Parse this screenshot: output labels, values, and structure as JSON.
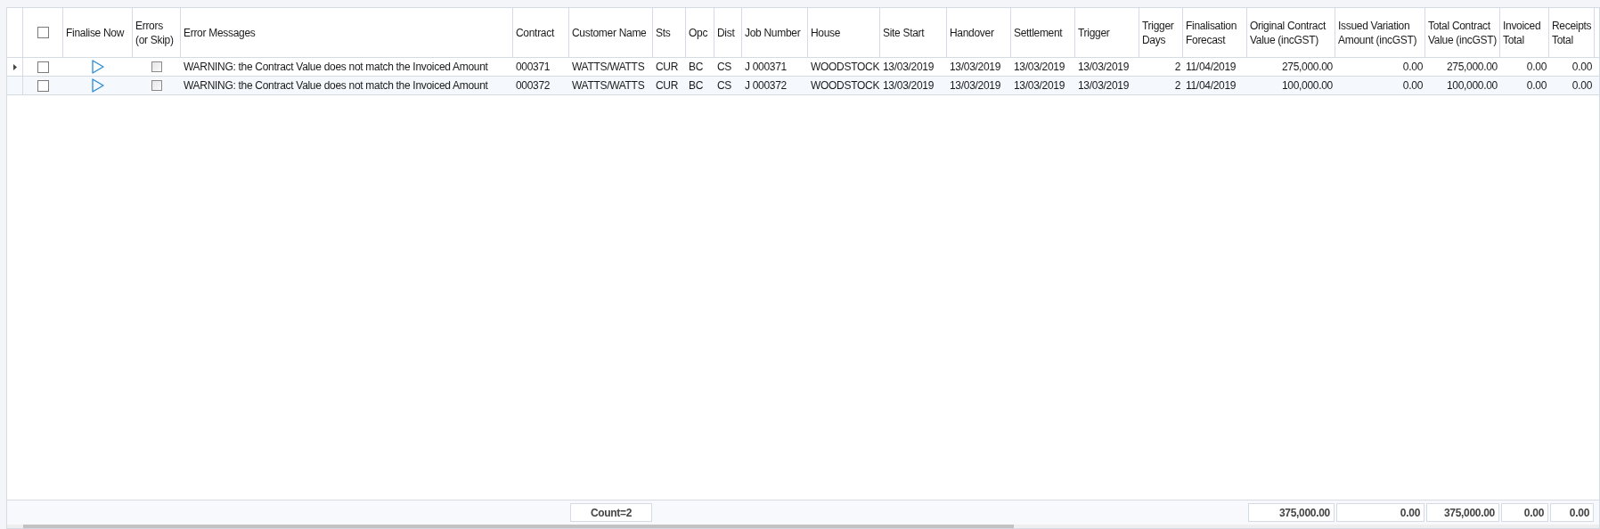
{
  "header_checkbox": {
    "checked": false
  },
  "columns": [
    {
      "label": "Finalise Now",
      "kind": "icon"
    },
    {
      "label": "Errors (or Skip)",
      "kind": "check"
    },
    {
      "label": "Error Messages",
      "kind": "text"
    },
    {
      "label": "Contract",
      "kind": "text"
    },
    {
      "label": "Customer Name",
      "kind": "text"
    },
    {
      "label": "Sts",
      "kind": "text"
    },
    {
      "label": "Opc",
      "kind": "text"
    },
    {
      "label": "Dist",
      "kind": "text"
    },
    {
      "label": "Job Number",
      "kind": "text"
    },
    {
      "label": "House",
      "kind": "text"
    },
    {
      "label": "Site Start",
      "kind": "text"
    },
    {
      "label": "Handover",
      "kind": "text"
    },
    {
      "label": "Settlement",
      "kind": "text"
    },
    {
      "label": "Trigger",
      "kind": "text"
    },
    {
      "label": "Trigger Days",
      "kind": "number"
    },
    {
      "label": "Finalisation Forecast",
      "kind": "text"
    },
    {
      "label": "Original Contract Value (incGST)",
      "kind": "number"
    },
    {
      "label": "Issued Variation Amount (incGST)",
      "kind": "number"
    },
    {
      "label": "Total Contract Value (incGST)",
      "kind": "number"
    },
    {
      "label": "Invoiced Total",
      "kind": "number"
    },
    {
      "label": "Receipts Total",
      "kind": "number"
    }
  ],
  "rows": [
    {
      "current": true,
      "checked": false,
      "skip": false,
      "cells": [
        "WARNING: the Contract Value does not match the Invoiced Amount",
        "000371",
        "WATTS/WATTS",
        "CUR",
        "BC",
        "CS",
        "J 000371",
        "WOODSTOCK",
        "13/03/2019",
        "13/03/2019",
        "13/03/2019",
        "13/03/2019",
        "2",
        "11/04/2019",
        "275,000.00",
        "0.00",
        "275,000.00",
        "0.00",
        "0.00"
      ]
    },
    {
      "current": false,
      "checked": false,
      "skip": false,
      "cells": [
        "WARNING: the Contract Value does not match the Invoiced Amount",
        "000372",
        "WATTS/WATTS",
        "CUR",
        "BC",
        "CS",
        "J 000372",
        "WOODSTOCK",
        "13/03/2019",
        "13/03/2019",
        "13/03/2019",
        "13/03/2019",
        "2",
        "11/04/2019",
        "100,000.00",
        "0.00",
        "100,000.00",
        "0.00",
        "0.00"
      ]
    }
  ],
  "footer": {
    "count": "Count=2",
    "totals": [
      "375,000.00",
      "0.00",
      "375,000.00",
      "0.00",
      "0.00"
    ]
  }
}
